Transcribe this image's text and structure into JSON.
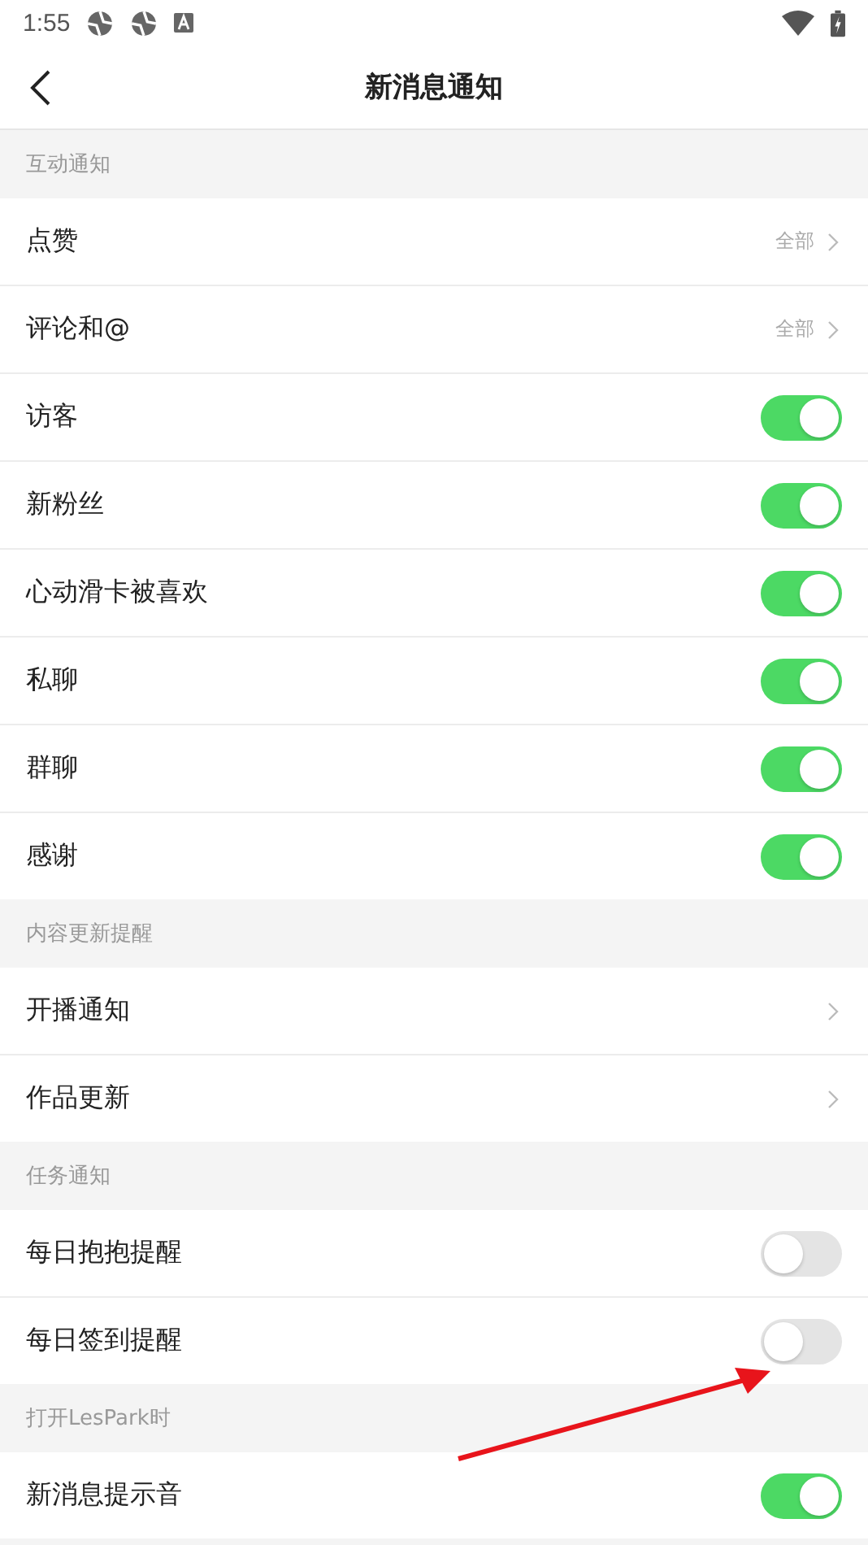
{
  "status_bar": {
    "time": "1:55"
  },
  "header": {
    "title": "新消息通知"
  },
  "sections": [
    {
      "title": "互动通知",
      "rows": [
        {
          "kind": "link",
          "label": "点赞",
          "value": "全部"
        },
        {
          "kind": "link",
          "label": "评论和@",
          "value": "全部"
        },
        {
          "kind": "toggle",
          "label": "访客",
          "on": true
        },
        {
          "kind": "toggle",
          "label": "新粉丝",
          "on": true
        },
        {
          "kind": "toggle",
          "label": "心动滑卡被喜欢",
          "on": true
        },
        {
          "kind": "toggle",
          "label": "私聊",
          "on": true
        },
        {
          "kind": "toggle",
          "label": "群聊",
          "on": true
        },
        {
          "kind": "toggle",
          "label": "感谢",
          "on": true
        }
      ]
    },
    {
      "title": "内容更新提醒",
      "rows": [
        {
          "kind": "link",
          "label": "开播通知"
        },
        {
          "kind": "link",
          "label": "作品更新"
        }
      ]
    },
    {
      "title": "任务通知",
      "rows": [
        {
          "kind": "toggle",
          "label": "每日抱抱提醒",
          "on": false
        },
        {
          "kind": "toggle",
          "label": "每日签到提醒",
          "on": false
        }
      ]
    },
    {
      "title": "打开LesPark时",
      "rows": [
        {
          "kind": "toggle",
          "label": "新消息提示音",
          "on": true
        }
      ]
    }
  ]
}
